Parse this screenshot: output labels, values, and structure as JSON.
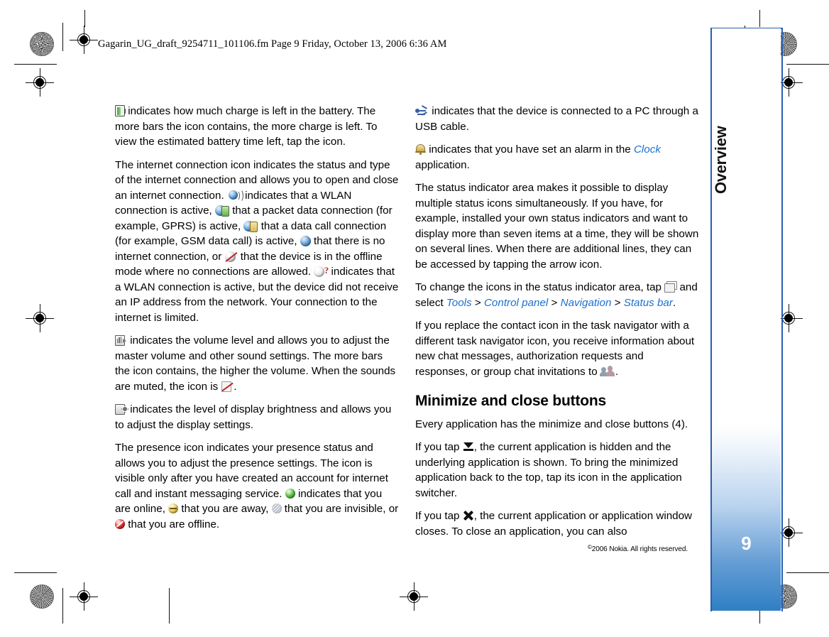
{
  "document": {
    "file_info": "Gagarin_UG_draft_9254711_101106.fm  Page 9  Friday, October 13, 2006  6:36 AM",
    "chapter_tab": "Overview",
    "page_number": "9",
    "copyright_symbol": "©",
    "copyright": "2006 Nokia. All rights reserved."
  },
  "left_column": {
    "p1": {
      "icon": "battery-icon",
      "text": " indicates how much charge is left in the battery. The more bars the icon contains, the more charge is left. To view the estimated battery time left, tap the icon."
    },
    "p2": {
      "t1": "The internet connection icon indicates the status and type of the internet connection and allows you to open and close an internet connection. ",
      "t2": " indicates that a WLAN connection is active, ",
      "t3": " that a packet data connection (for example, GPRS) is active, ",
      "t4": " that a data call connection (for example, GSM data call) is active, ",
      "t5": " that there is no internet connection, or ",
      "t6": " that the device is in the offline mode where no connections are allowed. ",
      "t7": " indicates that a WLAN connection is active, but the device did not receive an IP address from the network. Your connection to the internet is limited."
    },
    "p3": {
      "t1": " indicates the volume level and allows you to adjust the master volume and other sound settings. The more bars the icon contains, the higher the volume. When the sounds are muted, the icon is ",
      "t2": "."
    },
    "p4": {
      "t1": " indicates the level of display brightness and allows you to adjust the display settings."
    },
    "p5": {
      "t1": "The presence icon indicates your presence status and allows you to adjust the presence settings. The icon is visible only after you have created an account for internet call and instant messaging service. ",
      "t2": " indicates that you are online, ",
      "t3": " that you are away, ",
      "t4": " that you are invisible, or ",
      "t5": " that you are offline."
    }
  },
  "right_column": {
    "p1": {
      "t1": " indicates that the device is connected to a PC through a USB cable."
    },
    "p2": {
      "t1": " indicates that you have set an alarm in the ",
      "link": "Clock",
      "t2": " application."
    },
    "p3": {
      "t1": "The status indicator area makes it possible to display multiple status icons simultaneously. If you have, for example, installed your own status indicators and want to display more than seven items at a time, they will be shown on several lines. When there are additional lines, they can be accessed by tapping the arrow icon."
    },
    "p4": {
      "t1": "To change the icons in the status indicator area, tap ",
      "t2": " and select ",
      "link1": "Tools",
      "sep1": " > ",
      "link2": "Control panel",
      "sep2": " > ",
      "link3": "Navigation",
      "sep3": " > ",
      "link4": "Status bar",
      "t3": "."
    },
    "p5": {
      "t1": "If you replace the contact icon in the task navigator with a different task navigator icon, you receive information about new chat messages, authorization requests and responses, or group chat invitations to ",
      "t2": "."
    },
    "heading": "Minimize and close buttons",
    "p6": {
      "t1": "Every application has the minimize and close buttons (4)."
    },
    "p7": {
      "t1": "If you tap ",
      "t2": ", the current application is hidden and the underlying application is shown. To bring the minimized application back to the top, tap its icon in the application switcher."
    },
    "p8": {
      "t1": "If you tap ",
      "t2": ", the current application or application window closes. To close an application, you can also"
    }
  },
  "colors": {
    "link": "#1c70d0",
    "tab_blue": "#2f7fc4",
    "frame_blue": "#2a5fae"
  }
}
